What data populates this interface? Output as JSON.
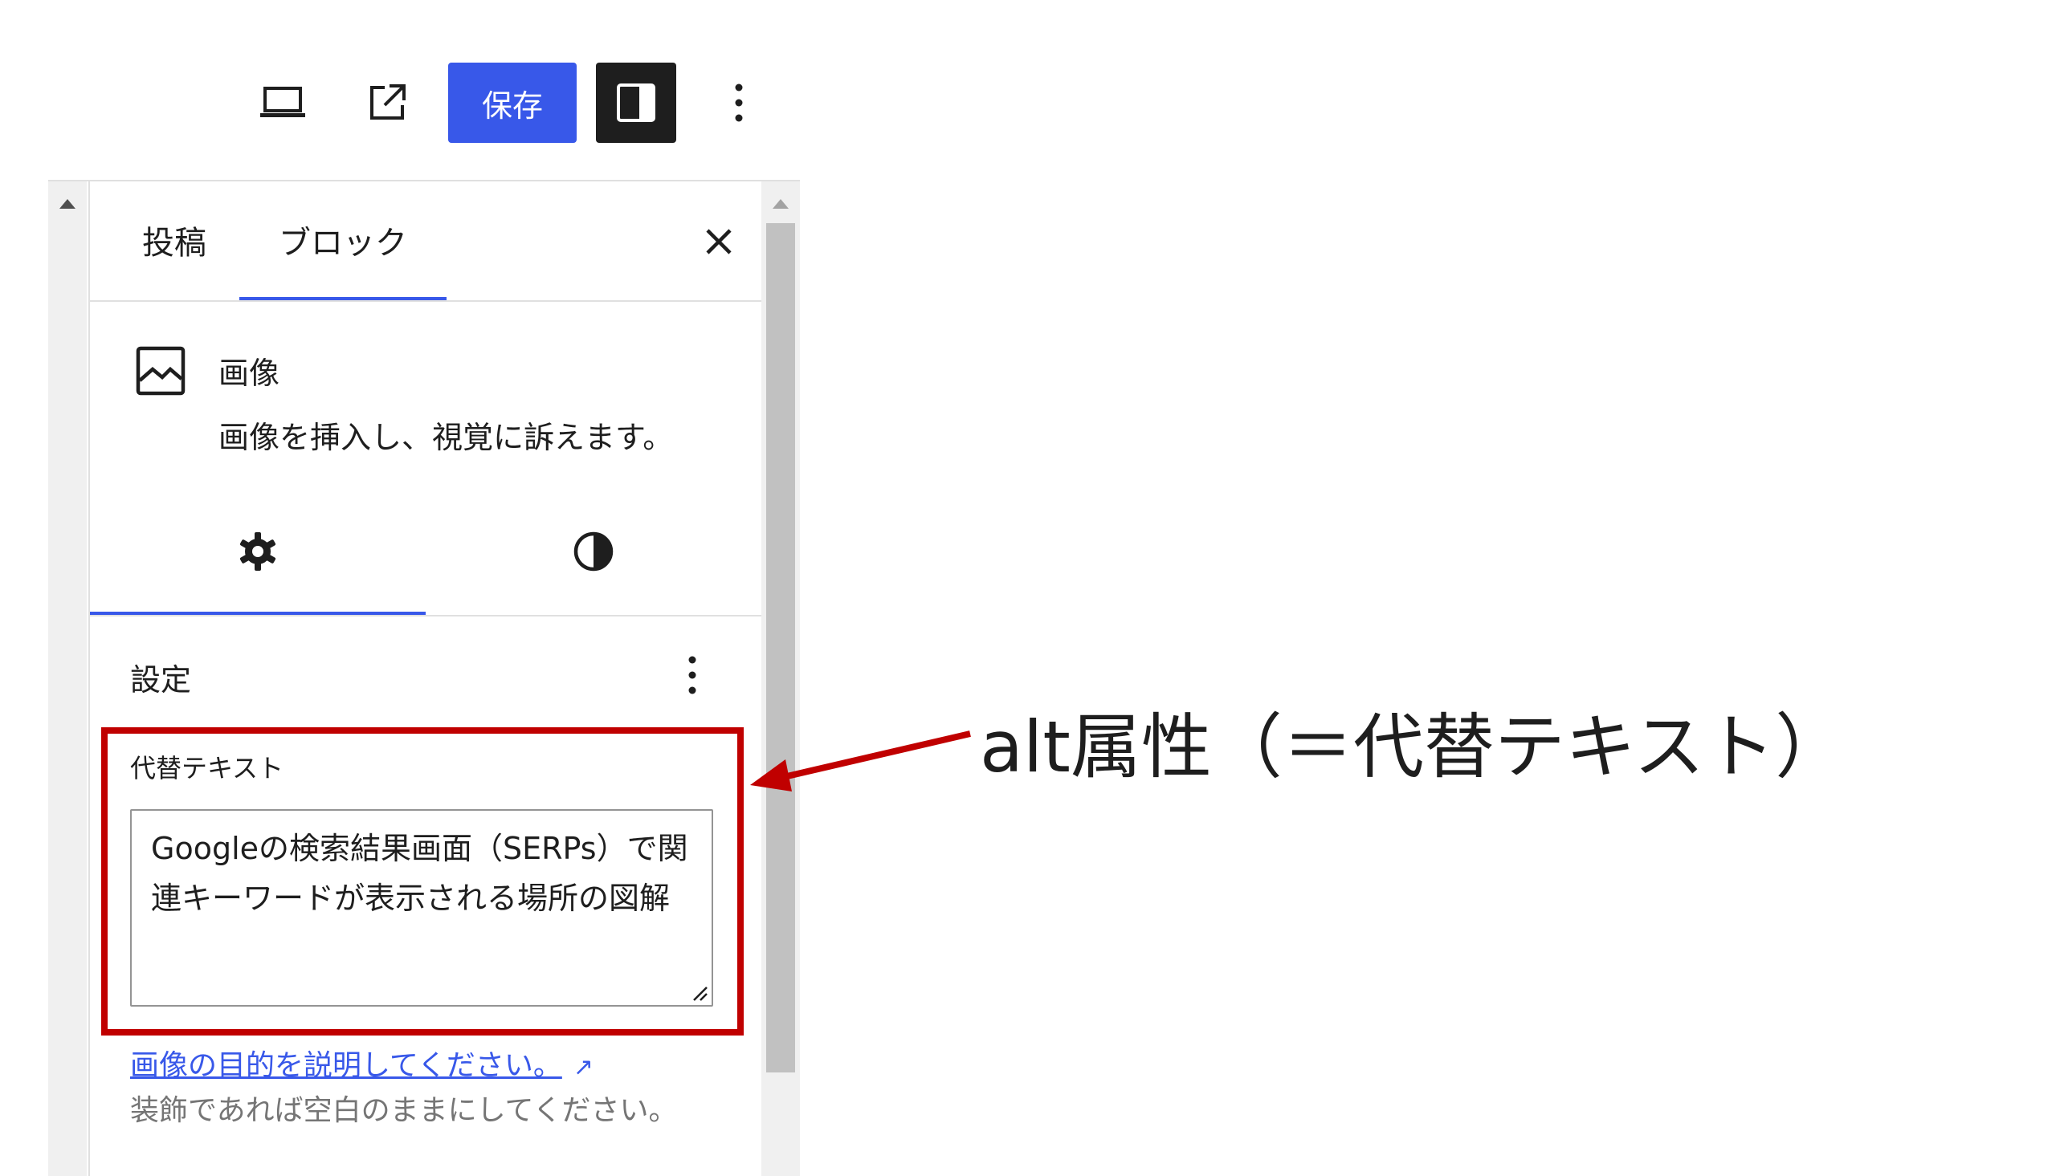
{
  "toolbar": {
    "preview_icon": "laptop-icon",
    "view_icon": "external-link-icon",
    "save_label": "保存",
    "settings_icon": "sidebar-panel-icon",
    "more_icon": "more-vertical-icon"
  },
  "sidebar": {
    "tabs": [
      {
        "label": "投稿"
      },
      {
        "label": "ブロック"
      }
    ],
    "close_icon": "close-icon",
    "block": {
      "icon": "image-icon",
      "title": "画像",
      "description": "画像を挿入し、視覚に訴えます。"
    },
    "inspector_tabs": {
      "settings_icon": "gear-icon",
      "styles_icon": "half-circle-icon"
    },
    "settings": {
      "title": "設定",
      "alt_label": "代替テキスト",
      "alt_value": "Googleの検索結果画面（SERPs）で関連キーワードが表示される場所の図解",
      "help_link": "画像の目的を説明してください。",
      "help_text": "装飾であれば空白のままにしてください。"
    }
  },
  "annotation": {
    "label": "alt属性（＝代替テキスト）"
  },
  "colors": {
    "accent": "#3858e9",
    "highlight": "#c00000",
    "dark": "#1e1e1e"
  }
}
